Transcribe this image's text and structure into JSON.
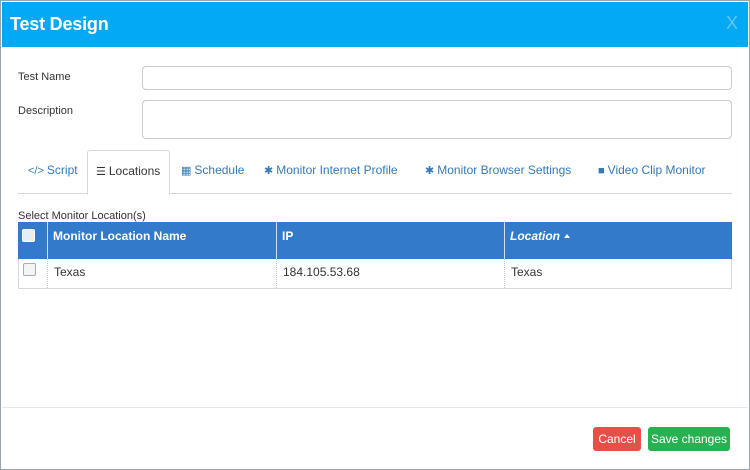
{
  "header": {
    "title": "Test Design",
    "close_glyph": "X"
  },
  "form": {
    "test_name_label": "Test Name",
    "test_name_value": "",
    "description_label": "Description",
    "description_value": ""
  },
  "tabs": [
    {
      "label": "Script",
      "icon": "code-icon",
      "glyph": "</>",
      "active": false
    },
    {
      "label": "Locations",
      "icon": "sliders-icon",
      "glyph": "☰",
      "active": true
    },
    {
      "label": "Schedule",
      "icon": "calendar-icon",
      "glyph": "▦",
      "active": false
    },
    {
      "label": "Monitor Internet Profile",
      "icon": "gear-icon",
      "glyph": "✱",
      "active": false
    },
    {
      "label": "Monitor Browser Settings",
      "icon": "gears-icon",
      "glyph": "✱",
      "active": false
    },
    {
      "label": "Video Clip Monitor",
      "icon": "camera-icon",
      "glyph": "■",
      "active": false
    }
  ],
  "locations": {
    "section_label": "Select Monitor Location(s)",
    "columns": [
      "Monitor Location Name",
      "IP",
      "Location"
    ],
    "sorted_column": "Location",
    "rows": [
      {
        "name": "Texas",
        "ip": "184.105.53.68",
        "location": "Texas",
        "checked": false
      }
    ]
  },
  "footer": {
    "cancel_label": "Cancel",
    "save_label": "Save changes"
  },
  "colors": {
    "header": "#03a9f4",
    "grid_header": "#337acb",
    "cancel": "#e84f48",
    "save": "#27b251",
    "link": "#337ab7"
  }
}
